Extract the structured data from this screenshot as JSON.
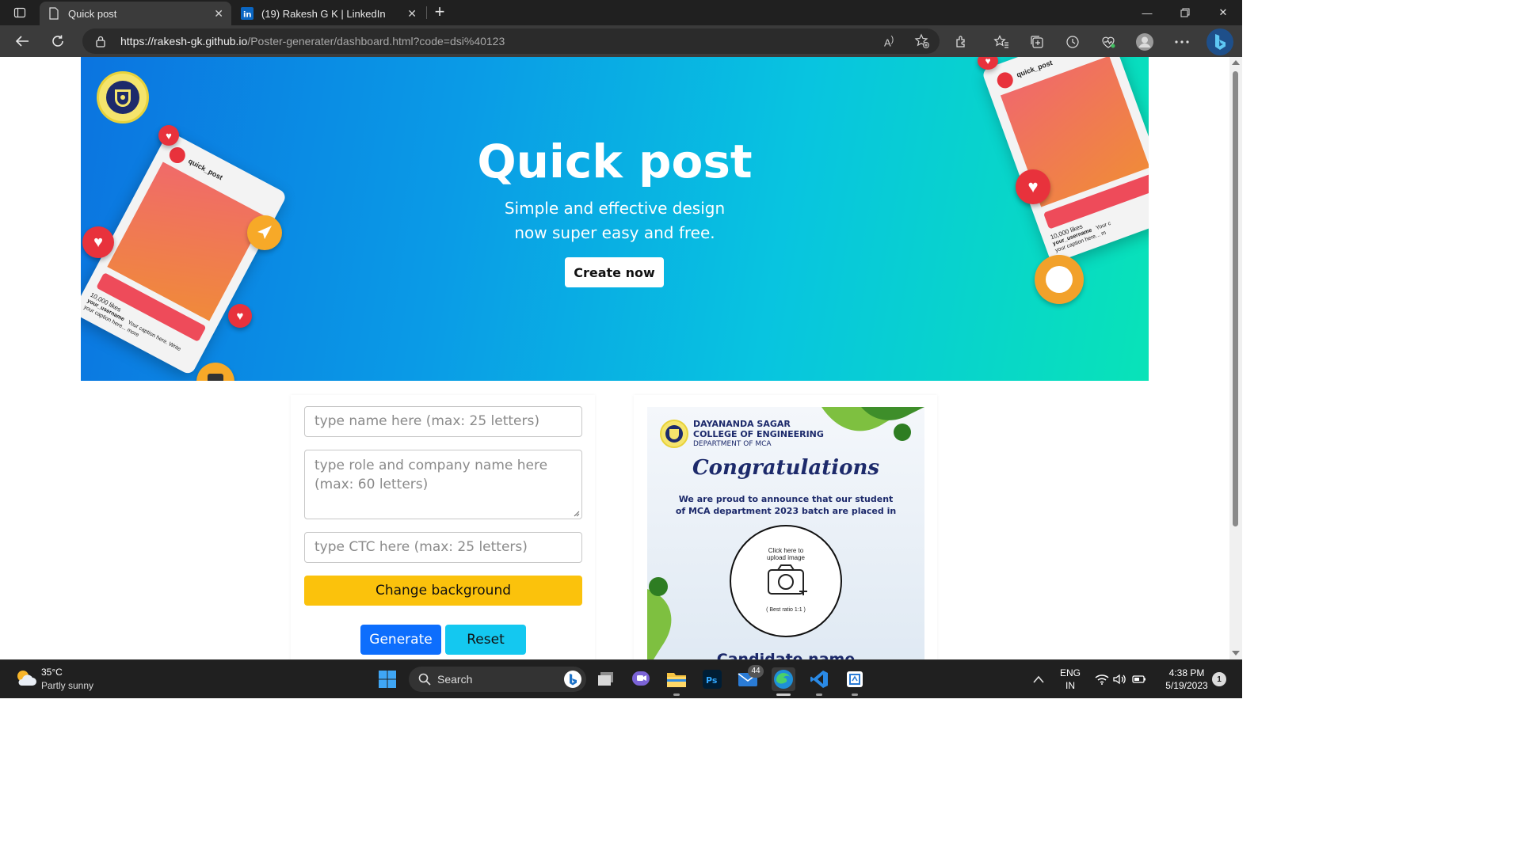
{
  "browser": {
    "tabs": [
      {
        "label": "Quick post",
        "active": true
      },
      {
        "label": "(19) Rakesh G K | LinkedIn",
        "active": false
      }
    ],
    "url_host": "https://rakesh-gk.github.io",
    "url_path": "/Poster-generater/dashboard.html?code=dsi%40123"
  },
  "hero": {
    "title": "Quick post",
    "subtitle_line1": "Simple and effective design",
    "subtitle_line2": "now super easy and free.",
    "cta": "Create now",
    "phone_left": {
      "handle": "quick_post",
      "likes": "10,000 likes",
      "caption_user": "your_username",
      "caption_text": "Your caption here. Write",
      "caption_more": "your caption here... more"
    },
    "phone_right": {
      "handle": "quick_post",
      "likes": "10,000 likes",
      "caption_user": "your_username",
      "caption_text": "Your c",
      "caption_more": "your caption here... m"
    }
  },
  "form": {
    "name_placeholder": "type name here (max: 25 letters)",
    "role_placeholder": "type role and company name here (max: 60 letters)",
    "ctc_placeholder": "type CTC here (max: 25 letters)",
    "bg_button": "Change background",
    "generate_button": "Generate",
    "reset_button": "Reset"
  },
  "poster": {
    "org_line1": "DAYANANDA SAGAR",
    "org_line2": "COLLEGE OF ENGINEERING",
    "org_line3": "DEPARTMENT OF MCA",
    "congratulations": "Congratulations",
    "announce_line1": "We are proud to announce that our student",
    "announce_line2": "of MCA department 2023 batch are placed in",
    "upload_hint_line1": "Click here to",
    "upload_hint_line2": "upload image",
    "ratio_hint": "( Best ratio 1:1 )",
    "candidate_name": "Candidate name"
  },
  "taskbar": {
    "weather_temp": "35°C",
    "weather_desc": "Partly sunny",
    "search_label": "Search",
    "mail_badge": "44",
    "lang_line1": "ENG",
    "lang_line2": "IN",
    "time": "4:38 PM",
    "date": "5/19/2023",
    "notification_count": "1"
  },
  "colors": {
    "hero_start": "#0b74e0",
    "hero_end": "#08e3b8",
    "generate": "#0d6efd",
    "reset": "#14c8f0",
    "change_bg": "#fbc20c",
    "navy": "#1d2a6b"
  }
}
